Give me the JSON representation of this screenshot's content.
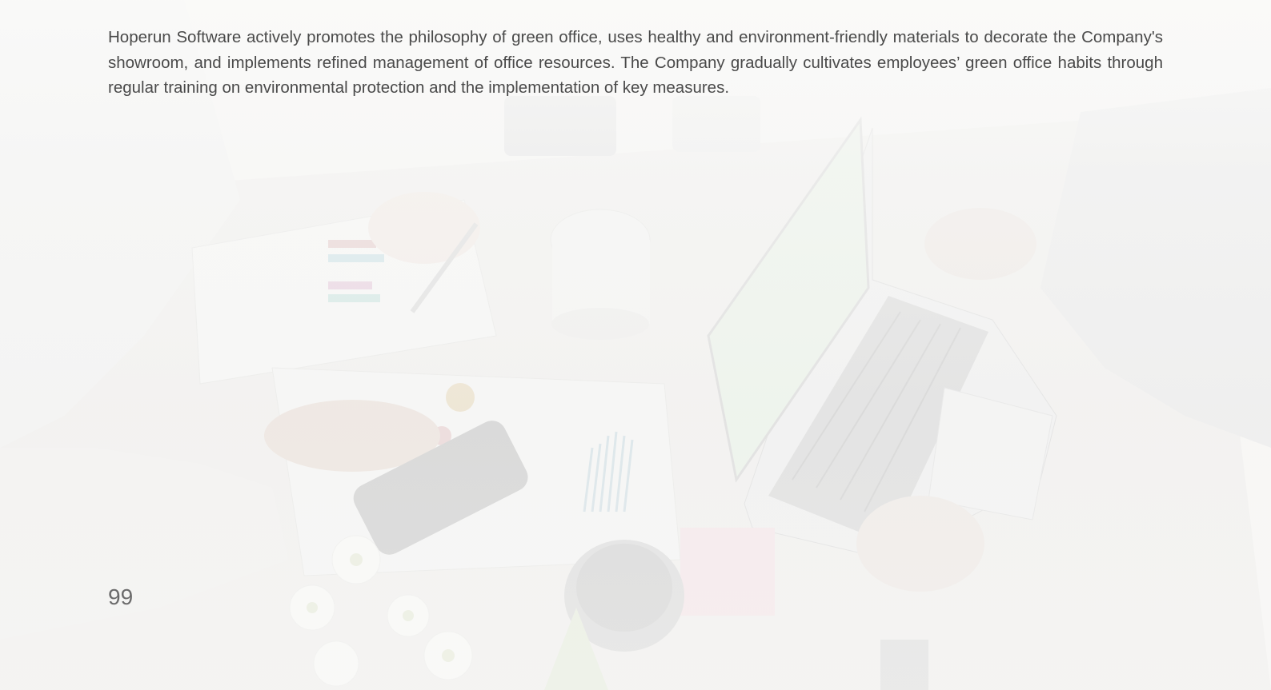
{
  "page": {
    "body_text": "Hoperun Software actively promotes the philosophy of green office, uses healthy and environment-friendly materials to decorate the Company's showroom, and implements refined management of office resources. The Company gradually cultivates employees’ green office habits through regular training on environmental protection and the implementation of key measures.",
    "page_number": "99"
  },
  "colors": {
    "text": "#4a4a4a",
    "page_number": "#6b6b6b",
    "background": "#f7f7f6"
  }
}
